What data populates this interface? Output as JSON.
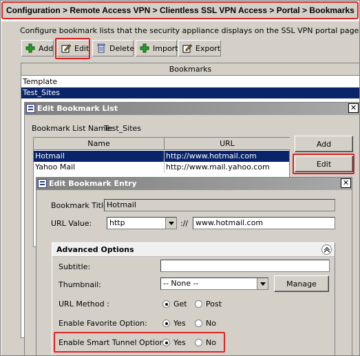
{
  "breadcrumb": "Configuration > Remote Access VPN > Clientless SSL VPN Access > Portal > Bookmarks",
  "description": "Configure bookmark lists that the security appliance displays on the SSL VPN portal page.",
  "toolbar": {
    "add": "Add",
    "edit": "Edit",
    "delete": "Delete",
    "import": "Import",
    "export": "Export"
  },
  "bookmarks": {
    "header": "Bookmarks",
    "items": [
      "Template",
      "Test_Sites"
    ]
  },
  "edit_list_dialog": {
    "title": "Edit Bookmark List",
    "name_label": "Bookmark List Name:",
    "name_value": "Test_Sites",
    "columns": [
      "Name",
      "URL"
    ],
    "rows": [
      {
        "name": "Hotmail",
        "url": "http://www.hotmail.com"
      },
      {
        "name": "Yahoo Mail",
        "url": "http://www.mail.yahoo.com"
      }
    ],
    "add_button": "Add",
    "edit_button": "Edit"
  },
  "edit_entry_dialog": {
    "title": "Edit Bookmark Entry",
    "title_label": "Bookmark Title:",
    "title_value": "Hotmail",
    "url_label": "URL Value:",
    "url_protocol": "http",
    "url_sep": "://",
    "url_value": "www.hotmail.com",
    "advanced": {
      "header": "Advanced Options",
      "subtitle_label": "Subtitle:",
      "subtitle_value": "",
      "thumbnail_label": "Thumbnail:",
      "thumbnail_value": "-- None --",
      "manage_button": "Manage",
      "url_method_label": "URL Method :",
      "url_method_options": [
        "Get",
        "Post"
      ],
      "url_method_selected": "Get",
      "favorite_label": "Enable Favorite Option:",
      "favorite_options": [
        "Yes",
        "No"
      ],
      "favorite_selected": "Yes",
      "smart_tunnel_label": "Enable Smart Tunnel Option:",
      "smart_tunnel_options": [
        "Yes",
        "No"
      ],
      "smart_tunnel_selected": "Yes"
    }
  },
  "colors": {
    "highlight": "#e02020",
    "selection": "#0a246a",
    "panel": "#d4d0c8"
  }
}
